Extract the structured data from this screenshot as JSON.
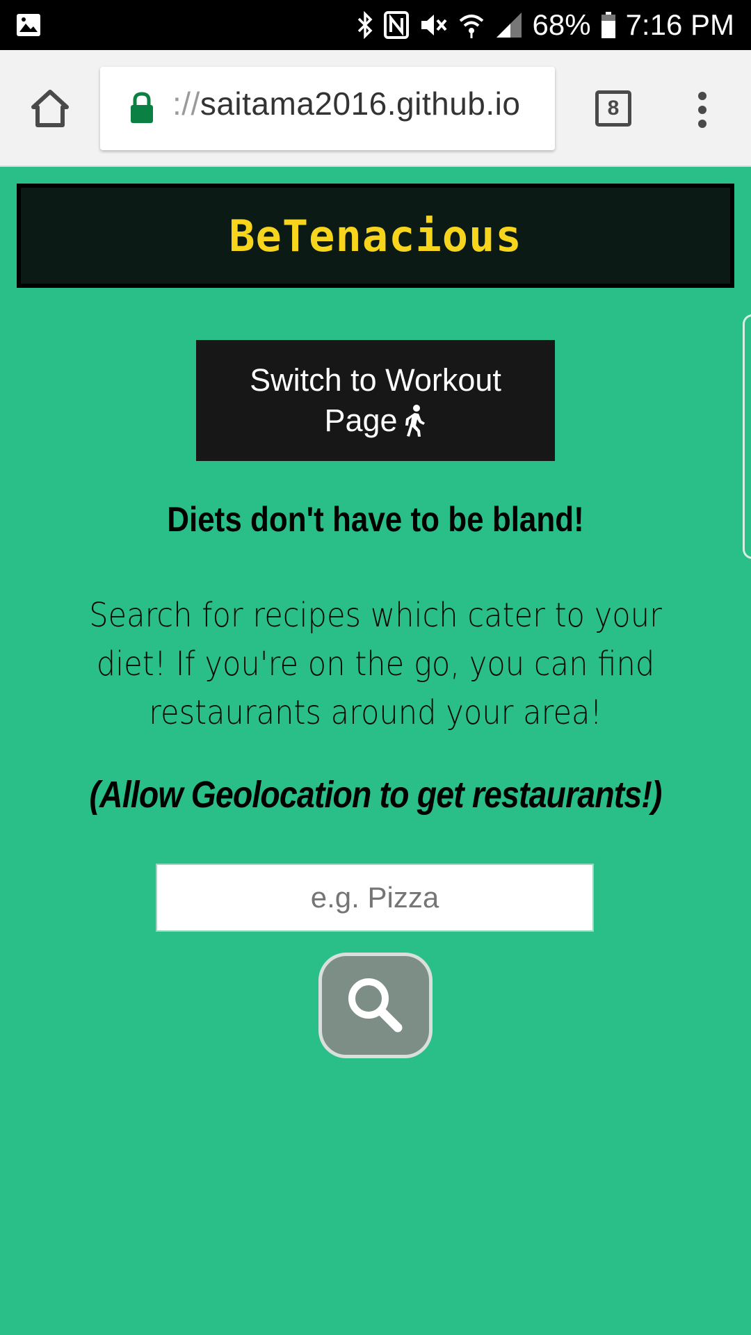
{
  "status_bar": {
    "battery_percent": "68%",
    "time": "7:16 PM",
    "icons": [
      "gallery-icon",
      "bluetooth-icon",
      "nfc-icon",
      "mute-icon",
      "wifi-icon",
      "signal-icon",
      "battery-icon"
    ]
  },
  "browser": {
    "url_scheme": "://",
    "url_host": "saitama2016.github.io",
    "tab_count": "8",
    "colors": {
      "lock": "#0b8043",
      "toolbar": "#f2f2f2"
    }
  },
  "page": {
    "brand": "BeTenacious",
    "switch_button": {
      "line1": "Switch to Workout",
      "line2": "Page"
    },
    "tagline": "Diets don't have to be bland!",
    "description": "Search for recipes which cater to your diet! If you're on the go, you can find restaurants around your area!",
    "geo_note": "(Allow Geolocation to get restaurants!)",
    "search": {
      "placeholder": "e.g. Pizza",
      "value": ""
    },
    "colors": {
      "background": "#2abf88",
      "brand_text": "#f7d51d",
      "banner": "#0b1a15",
      "search_button": "#7d8e86"
    }
  }
}
